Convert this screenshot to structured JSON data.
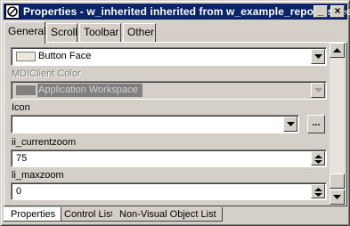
{
  "window": {
    "title": "Properties - w_inherited inherited from w_example_report_sheet",
    "controls": {
      "minimize": "_",
      "close": "×"
    }
  },
  "tabs": [
    {
      "label": "General",
      "active": true
    },
    {
      "label": "Scroll"
    },
    {
      "label": "Toolbar"
    },
    {
      "label": "Other"
    }
  ],
  "fields": {
    "backcolor": {
      "value": "Button Face",
      "swatch_color": "#ece9d8"
    },
    "mdiclient_color": {
      "label": "MDIClient Color",
      "value": "Application Workspace",
      "swatch_color": "#808080"
    },
    "icon": {
      "label": "Icon",
      "value": "",
      "button_label": "..."
    },
    "ii_currentzoom": {
      "label": "ii_currentzoom",
      "value": "75"
    },
    "li_maxzoom": {
      "label": "li_maxzoom",
      "value": "0"
    }
  },
  "bottom_tabs": [
    {
      "label": "Properties",
      "active": true
    },
    {
      "label": "Control List"
    },
    {
      "label": "Non-Visual Object List"
    }
  ]
}
